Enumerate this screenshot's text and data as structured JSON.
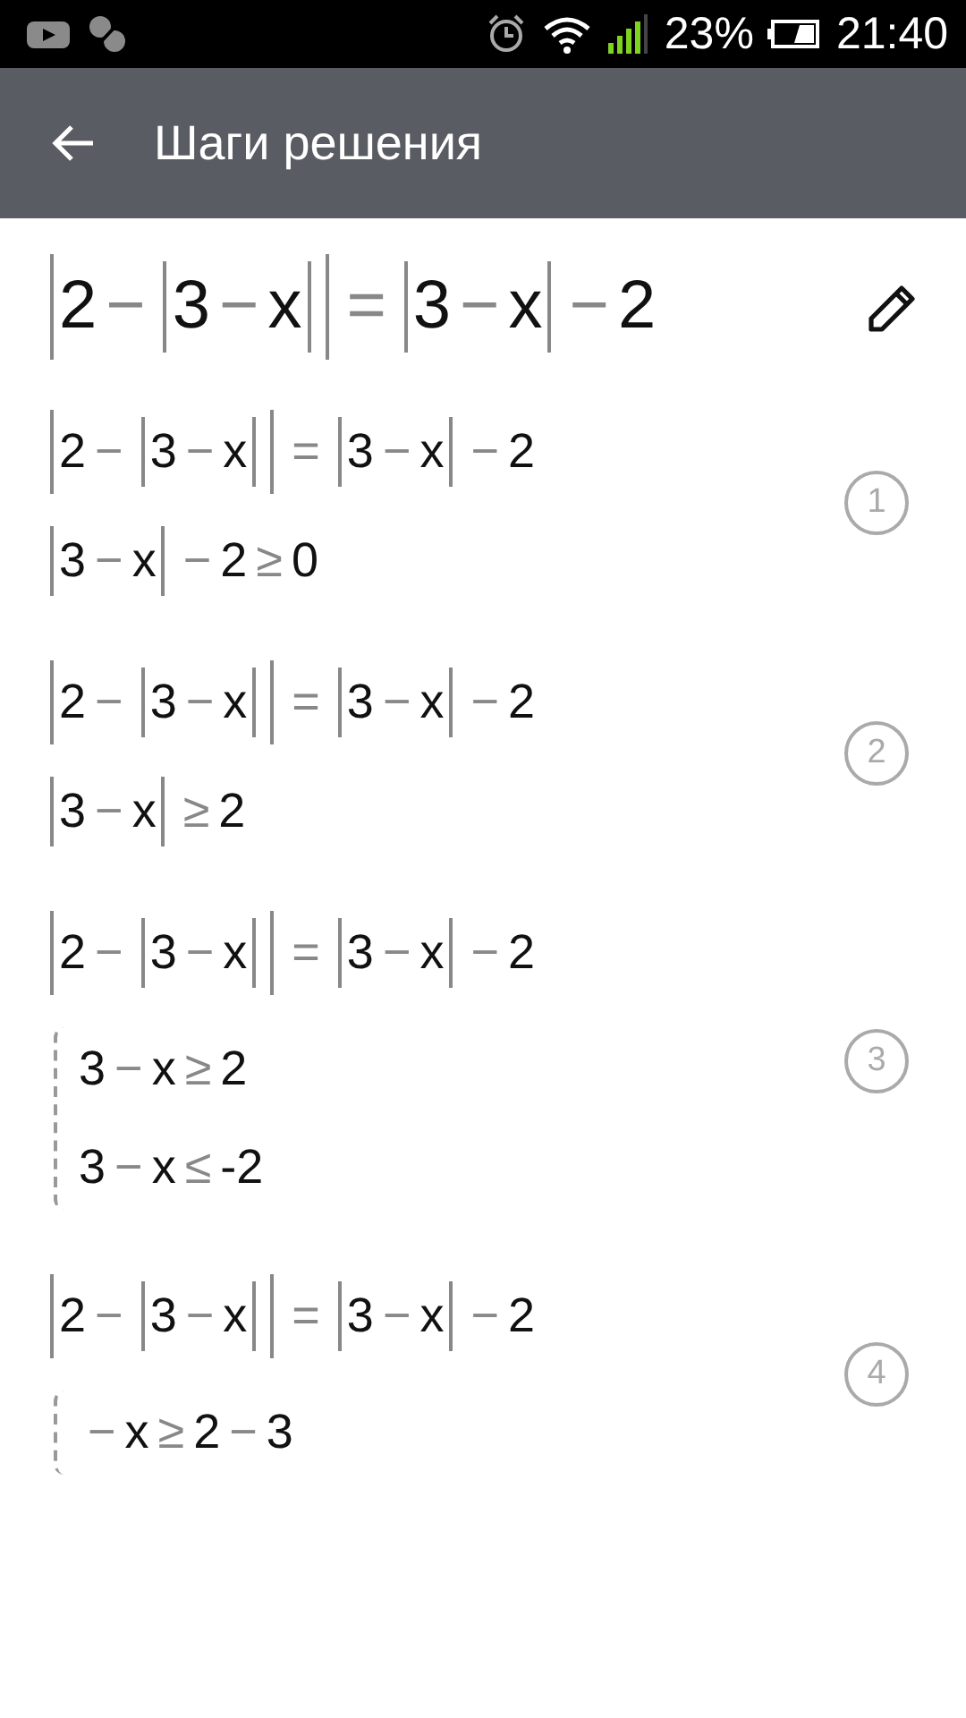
{
  "status_bar": {
    "battery_percent": "23%",
    "time": "21:40"
  },
  "app_bar": {
    "title": "Шаги решения"
  },
  "problem": {
    "tokens": [
      {
        "kind": "abs",
        "children": [
          {
            "kind": "num",
            "text": "2"
          },
          {
            "kind": "op",
            "text": "−"
          },
          {
            "kind": "abs",
            "children": [
              {
                "kind": "num",
                "text": "3"
              },
              {
                "kind": "op",
                "text": "−"
              },
              {
                "kind": "num",
                "text": "x"
              }
            ]
          }
        ]
      },
      {
        "kind": "op",
        "text": "="
      },
      {
        "kind": "abs",
        "children": [
          {
            "kind": "num",
            "text": "3"
          },
          {
            "kind": "op",
            "text": "−"
          },
          {
            "kind": "num",
            "text": "x"
          }
        ]
      },
      {
        "kind": "op",
        "text": "−"
      },
      {
        "kind": "num",
        "text": "2"
      }
    ]
  },
  "steps": [
    {
      "number": "1",
      "lines": [
        {
          "kind": "expr",
          "tokens": [
            {
              "kind": "abs",
              "children": [
                {
                  "kind": "num",
                  "text": "2"
                },
                {
                  "kind": "op",
                  "text": "−"
                },
                {
                  "kind": "abs",
                  "children": [
                    {
                      "kind": "num",
                      "text": "3"
                    },
                    {
                      "kind": "op",
                      "text": "−"
                    },
                    {
                      "kind": "num",
                      "text": "x"
                    }
                  ]
                }
              ]
            },
            {
              "kind": "op",
              "text": "="
            },
            {
              "kind": "abs",
              "children": [
                {
                  "kind": "num",
                  "text": "3"
                },
                {
                  "kind": "op",
                  "text": "−"
                },
                {
                  "kind": "num",
                  "text": "x"
                }
              ]
            },
            {
              "kind": "op",
              "text": "−"
            },
            {
              "kind": "num",
              "text": "2"
            }
          ]
        },
        {
          "kind": "expr",
          "tokens": [
            {
              "kind": "abs",
              "children": [
                {
                  "kind": "num",
                  "text": "3"
                },
                {
                  "kind": "op",
                  "text": "−"
                },
                {
                  "kind": "num",
                  "text": "x"
                }
              ]
            },
            {
              "kind": "op",
              "text": "−"
            },
            {
              "kind": "num",
              "text": "2"
            },
            {
              "kind": "op",
              "text": "≥"
            },
            {
              "kind": "num",
              "text": "0"
            }
          ]
        }
      ]
    },
    {
      "number": "2",
      "lines": [
        {
          "kind": "expr",
          "tokens": [
            {
              "kind": "abs",
              "children": [
                {
                  "kind": "num",
                  "text": "2"
                },
                {
                  "kind": "op",
                  "text": "−"
                },
                {
                  "kind": "abs",
                  "children": [
                    {
                      "kind": "num",
                      "text": "3"
                    },
                    {
                      "kind": "op",
                      "text": "−"
                    },
                    {
                      "kind": "num",
                      "text": "x"
                    }
                  ]
                }
              ]
            },
            {
              "kind": "op",
              "text": "="
            },
            {
              "kind": "abs",
              "children": [
                {
                  "kind": "num",
                  "text": "3"
                },
                {
                  "kind": "op",
                  "text": "−"
                },
                {
                  "kind": "num",
                  "text": "x"
                }
              ]
            },
            {
              "kind": "op",
              "text": "−"
            },
            {
              "kind": "num",
              "text": "2"
            }
          ]
        },
        {
          "kind": "expr",
          "tokens": [
            {
              "kind": "abs",
              "children": [
                {
                  "kind": "num",
                  "text": "3"
                },
                {
                  "kind": "op",
                  "text": "−"
                },
                {
                  "kind": "num",
                  "text": "x"
                }
              ]
            },
            {
              "kind": "op",
              "text": "≥"
            },
            {
              "kind": "num",
              "text": "2"
            }
          ]
        }
      ]
    },
    {
      "number": "3",
      "lines": [
        {
          "kind": "expr",
          "tokens": [
            {
              "kind": "abs",
              "children": [
                {
                  "kind": "num",
                  "text": "2"
                },
                {
                  "kind": "op",
                  "text": "−"
                },
                {
                  "kind": "abs",
                  "children": [
                    {
                      "kind": "num",
                      "text": "3"
                    },
                    {
                      "kind": "op",
                      "text": "−"
                    },
                    {
                      "kind": "num",
                      "text": "x"
                    }
                  ]
                }
              ]
            },
            {
              "kind": "op",
              "text": "="
            },
            {
              "kind": "abs",
              "children": [
                {
                  "kind": "num",
                  "text": "3"
                },
                {
                  "kind": "op",
                  "text": "−"
                },
                {
                  "kind": "num",
                  "text": "x"
                }
              ]
            },
            {
              "kind": "op",
              "text": "−"
            },
            {
              "kind": "num",
              "text": "2"
            }
          ]
        },
        {
          "kind": "system",
          "rows": [
            [
              {
                "kind": "num",
                "text": "3"
              },
              {
                "kind": "op",
                "text": "−"
              },
              {
                "kind": "num",
                "text": "x"
              },
              {
                "kind": "op",
                "text": "≥"
              },
              {
                "kind": "num",
                "text": "2"
              }
            ],
            [
              {
                "kind": "num",
                "text": "3"
              },
              {
                "kind": "op",
                "text": "−"
              },
              {
                "kind": "num",
                "text": "x"
              },
              {
                "kind": "op",
                "text": "≤"
              },
              {
                "kind": "num",
                "text": "-2"
              }
            ]
          ]
        }
      ]
    },
    {
      "number": "4",
      "lines": [
        {
          "kind": "expr",
          "tokens": [
            {
              "kind": "abs",
              "children": [
                {
                  "kind": "num",
                  "text": "2"
                },
                {
                  "kind": "op",
                  "text": "−"
                },
                {
                  "kind": "abs",
                  "children": [
                    {
                      "kind": "num",
                      "text": "3"
                    },
                    {
                      "kind": "op",
                      "text": "−"
                    },
                    {
                      "kind": "num",
                      "text": "x"
                    }
                  ]
                }
              ]
            },
            {
              "kind": "op",
              "text": "="
            },
            {
              "kind": "abs",
              "children": [
                {
                  "kind": "num",
                  "text": "3"
                },
                {
                  "kind": "op",
                  "text": "−"
                },
                {
                  "kind": "num",
                  "text": "x"
                }
              ]
            },
            {
              "kind": "op",
              "text": "−"
            },
            {
              "kind": "num",
              "text": "2"
            }
          ]
        },
        {
          "kind": "system",
          "rows": [
            [
              {
                "kind": "op",
                "text": "−"
              },
              {
                "kind": "num",
                "text": "x"
              },
              {
                "kind": "op",
                "text": "≥"
              },
              {
                "kind": "num",
                "text": "2"
              },
              {
                "kind": "op",
                "text": "−"
              },
              {
                "kind": "num",
                "text": "3"
              }
            ]
          ]
        }
      ]
    }
  ]
}
